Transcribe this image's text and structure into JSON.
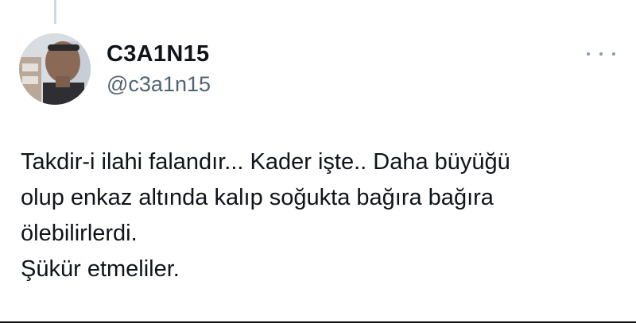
{
  "author": {
    "display_name": "C3A1N15",
    "handle": "@c3a1n15",
    "avatar_icon": "profile-photo"
  },
  "menu": {
    "icon": "more-horizontal-icon"
  },
  "tweet": {
    "lines": [
      "Takdir-i ilahi falandır... Kader işte.. Daha büyüğü",
      "olup enkaz altında kalıp soğukta bağıra bağıra",
      "ölebilirlerdi.",
      "Şükür etmeliler."
    ]
  },
  "colors": {
    "text_primary": "#0f1419",
    "text_secondary": "#536471",
    "thread_line": "#cfd9de"
  }
}
